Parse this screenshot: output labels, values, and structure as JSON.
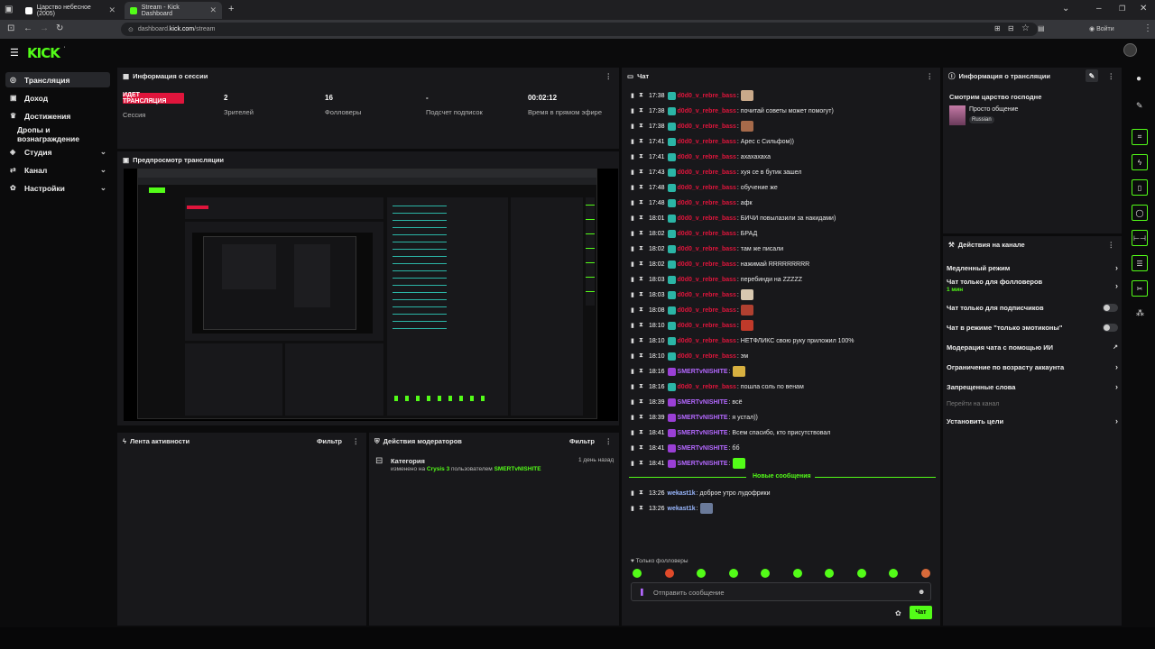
{
  "browser": {
    "tabs": [
      {
        "title": "Царство небесное (2005)"
      },
      {
        "title": "Stream - Kick Dashboard"
      }
    ],
    "url_prefix": "dashboard.",
    "url_domain": "kick.com",
    "url_path": "/stream",
    "login_label": "Войти"
  },
  "app": {
    "logo": "KICK"
  },
  "sidebar": {
    "items": [
      {
        "label": "Трансляция",
        "icon": "broadcast-icon"
      },
      {
        "label": "Доход",
        "icon": "wallet-icon"
      },
      {
        "label": "Достижения",
        "icon": "trophy-icon"
      },
      {
        "label": "Дропы и вознаграждение",
        "icon": ""
      },
      {
        "label": "Студия",
        "icon": "studio-icon"
      },
      {
        "label": "Канал",
        "icon": "channel-icon"
      },
      {
        "label": "Настройки",
        "icon": "gear-icon"
      }
    ]
  },
  "session": {
    "title": "Информация о сессии",
    "live_badge": "ИДЕТ ТРАНСЛЯЦИЯ",
    "session_label": "Сессия",
    "stats": [
      {
        "value": "2",
        "label": "Зрителей"
      },
      {
        "value": "16",
        "label": "Фолловеры"
      },
      {
        "value": "-",
        "label": "Подсчет подписок"
      },
      {
        "value": "00:02:12",
        "label": "Время в прямом эфире"
      }
    ]
  },
  "preview": {
    "title": "Предпросмотр трансляции"
  },
  "activity": {
    "title": "Лента активности",
    "filter": "Фильтр"
  },
  "mod_actions": {
    "title": "Действия модераторов",
    "filter": "Фильтр",
    "entry": {
      "title": "Категория",
      "time": "1 день назад",
      "text_prefix": "изменено на ",
      "category": "Crysis 3",
      "text_mid": " пользователем ",
      "user": "SMERTvNISHITE"
    }
  },
  "chat": {
    "title": "Чат",
    "messages": [
      {
        "time": "17:38",
        "user": "d0d0_v_rebre_bass",
        "color": "#e0153c",
        "text": ":",
        "emote": "#c9a98a",
        "badge": "teal"
      },
      {
        "time": "17:38",
        "user": "d0d0_v_rebre_bass",
        "color": "#e0153c",
        "text": ": почитай советы может помогут)",
        "emote": "",
        "badge": "teal"
      },
      {
        "time": "17:38",
        "user": "d0d0_v_rebre_bass",
        "color": "#e0153c",
        "text": ":",
        "emote": "#a66a4a",
        "badge": "teal"
      },
      {
        "time": "17:41",
        "user": "d0d0_v_rebre_bass",
        "color": "#e0153c",
        "text": ": Арес с Сильфом))",
        "emote": "",
        "badge": "teal"
      },
      {
        "time": "17:41",
        "user": "d0d0_v_rebre_bass",
        "color": "#e0153c",
        "text": ": ахахахаха",
        "emote": "",
        "badge": "teal"
      },
      {
        "time": "17:43",
        "user": "d0d0_v_rebre_bass",
        "color": "#e0153c",
        "text": ": хуя се в бутик зашел",
        "emote": "",
        "badge": "teal"
      },
      {
        "time": "17:48",
        "user": "d0d0_v_rebre_bass",
        "color": "#e0153c",
        "text": ": обучение же",
        "emote": "",
        "badge": "teal"
      },
      {
        "time": "17:48",
        "user": "d0d0_v_rebre_bass",
        "color": "#e0153c",
        "text": ": афк",
        "emote": "",
        "badge": "teal"
      },
      {
        "time": "18:01",
        "user": "d0d0_v_rebre_bass",
        "color": "#e0153c",
        "text": ": БИЧИ повылазили за накидами)",
        "emote": "",
        "badge": "teal"
      },
      {
        "time": "18:02",
        "user": "d0d0_v_rebre_bass",
        "color": "#e0153c",
        "text": ": БРАД",
        "emote": "",
        "badge": "teal"
      },
      {
        "time": "18:02",
        "user": "d0d0_v_rebre_bass",
        "color": "#e0153c",
        "text": ": там же писали",
        "emote": "",
        "badge": "teal"
      },
      {
        "time": "18:02",
        "user": "d0d0_v_rebre_bass",
        "color": "#e0153c",
        "text": ": нажимай RRRRRRRRR",
        "emote": "",
        "badge": "teal"
      },
      {
        "time": "18:03",
        "user": "d0d0_v_rebre_bass",
        "color": "#e0153c",
        "text": ": перебинди на ZZZZZ",
        "emote": "",
        "badge": "teal"
      },
      {
        "time": "18:03",
        "user": "d0d0_v_rebre_bass",
        "color": "#e0153c",
        "text": ":",
        "emote": "#d8c8b0",
        "badge": "teal"
      },
      {
        "time": "18:08",
        "user": "d0d0_v_rebre_bass",
        "color": "#e0153c",
        "text": ":",
        "emote": "#b04030",
        "badge": "teal"
      },
      {
        "time": "18:10",
        "user": "d0d0_v_rebre_bass",
        "color": "#e0153c",
        "text": ":",
        "emote": "#c03a2a",
        "badge": "teal"
      },
      {
        "time": "18:10",
        "user": "d0d0_v_rebre_bass",
        "color": "#e0153c",
        "text": ": НЕТФЛИКС свою руку приложил 100%",
        "emote": "",
        "badge": "teal"
      },
      {
        "time": "18:10",
        "user": "d0d0_v_rebre_bass",
        "color": "#e0153c",
        "text": ": эм",
        "emote": "",
        "badge": "teal"
      },
      {
        "time": "18:16",
        "user": "SMERTvNISHITE",
        "color": "#b468ff",
        "text": ":",
        "emote": "#d8b040",
        "badge": "purple"
      },
      {
        "time": "18:16",
        "user": "d0d0_v_rebre_bass",
        "color": "#e0153c",
        "text": ": пошла соль по венам",
        "emote": "",
        "badge": "teal"
      },
      {
        "time": "18:39",
        "user": "SMERTvNISHITE",
        "color": "#b468ff",
        "text": ": всё",
        "emote": "",
        "badge": "purple"
      },
      {
        "time": "18:39",
        "user": "SMERTvNISHITE",
        "color": "#b468ff",
        "text": ": я устал))",
        "emote": "",
        "badge": "purple"
      },
      {
        "time": "18:41",
        "user": "SMERTvNISHITE",
        "color": "#b468ff",
        "text": ": Всем спасибо, кто присутствовал",
        "emote": "",
        "badge": "purple"
      },
      {
        "time": "18:41",
        "user": "SMERTvNISHITE",
        "color": "#b468ff",
        "text": ": бб",
        "emote": "",
        "badge": "purple"
      },
      {
        "time": "18:41",
        "user": "SMERTvNISHITE",
        "color": "#b468ff",
        "text": ":",
        "emote": "#53fc18",
        "badge": "purple"
      }
    ],
    "new_messages_label": "Новые сообщения",
    "new_messages": [
      {
        "time": "13:26",
        "user": "wekast1k",
        "color": "#9ab8ff",
        "text": ": доброе утро лудофрики",
        "emote": ""
      },
      {
        "time": "13:26",
        "user": "wekast1k",
        "color": "#9ab8ff",
        "text": ": ",
        "emote": "#6a7a9a"
      }
    ],
    "followers_only_label": "Только фолловеры",
    "input_placeholder": "Отправить сообщение",
    "send_label": "Чат"
  },
  "stream_info": {
    "title": "Информация о трансляции",
    "stream_title": "Смотрим царство господне",
    "category": "Просто общение",
    "tag": "Russian"
  },
  "channel_actions": {
    "title": "Действия на канале",
    "rows": [
      {
        "label": "Медленный режим",
        "sub": "",
        "control": "chevron"
      },
      {
        "label": "Чат только для фолловеров",
        "sub": "1 мин",
        "control": "chevron"
      },
      {
        "label": "Чат только для подписчиков",
        "sub": "",
        "control": "toggle"
      },
      {
        "label": "Чат в режиме \"только эмотиконы\"",
        "sub": "",
        "control": "toggle"
      },
      {
        "label": "Модерация чата с помощью ИИ",
        "sub": "",
        "control": "external"
      },
      {
        "label": "Ограничение по возрасту аккаунта",
        "sub": "",
        "control": "chevron"
      },
      {
        "label": "Запрещенные слова",
        "sub": "",
        "control": "chevron"
      }
    ],
    "raid_label": "Перейти на канал",
    "goals_label": "Установить цели"
  },
  "colors": {
    "accent": "#53fc18",
    "live": "#e0153c"
  }
}
